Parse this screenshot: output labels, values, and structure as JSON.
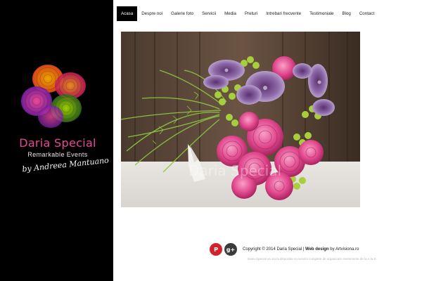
{
  "brand": {
    "name": "Daria Special",
    "subtitle": "Remarkable Events",
    "signature": "by Andreea Mantuano",
    "accent": "#e8479a"
  },
  "nav": {
    "items": [
      {
        "label": "Acasa",
        "active": true
      },
      {
        "label": "Despre noi"
      },
      {
        "label": "Galerie foto"
      },
      {
        "label": "Servicii"
      },
      {
        "label": "Media"
      },
      {
        "label": "Preturi"
      },
      {
        "label": "Intrebari frecvente"
      },
      {
        "label": "Testimoniale"
      },
      {
        "label": "Blog"
      },
      {
        "label": "Contact"
      }
    ]
  },
  "hero": {
    "watermark": "Daria Special",
    "image": "wedding-bouquet-photo"
  },
  "footer": {
    "social": [
      {
        "icon": "pinterest-icon",
        "glyph": "P",
        "color": "#d0232e"
      },
      {
        "icon": "google-plus-icon",
        "glyph": "g+",
        "color": "#3b3b3b"
      }
    ],
    "copyright_prefix": "Copyright © 2014 Daria Special | ",
    "webdesign_label": "Web design",
    "by_text": " by ",
    "designer": "Artvisiona.ro",
    "tagline": "Daria Special va sta la dispozitie cu servicii complete de organizare evenimente de la A la Z"
  }
}
